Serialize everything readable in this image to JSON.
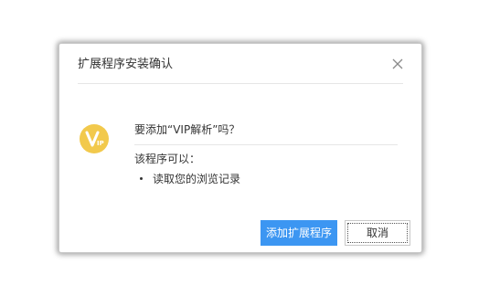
{
  "dialog": {
    "title": "扩展程序安装确认",
    "close_icon": "close-icon",
    "question": "要添加“VIP解析”吗？",
    "app_icon": "vip-logo-icon",
    "permissions_heading": "该程序可以：",
    "permissions": [
      "读取您的浏览记录"
    ],
    "buttons": {
      "add_label": "添加扩展程序",
      "cancel_label": "取消"
    },
    "colors": {
      "primary": "#3c96f2",
      "icon": "#f2c94c"
    }
  }
}
